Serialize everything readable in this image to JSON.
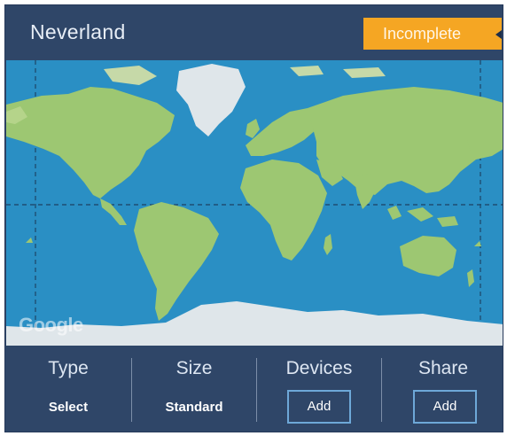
{
  "header": {
    "title": "Neverland",
    "status_badge": "Incomplete"
  },
  "map": {
    "provider_watermark": "Google",
    "colors": {
      "ocean": "#2a8fc4",
      "land": "#9dc772",
      "ice": "#dfe6ea"
    }
  },
  "footer": {
    "type": {
      "label": "Type",
      "value": "Select"
    },
    "size": {
      "label": "Size",
      "value": "Standard"
    },
    "devices": {
      "label": "Devices",
      "button": "Add"
    },
    "share": {
      "label": "Share",
      "button": "Add"
    }
  },
  "colors": {
    "panel": "#2f4668",
    "badge": "#f5a623",
    "button_border": "#6ea8d8"
  }
}
